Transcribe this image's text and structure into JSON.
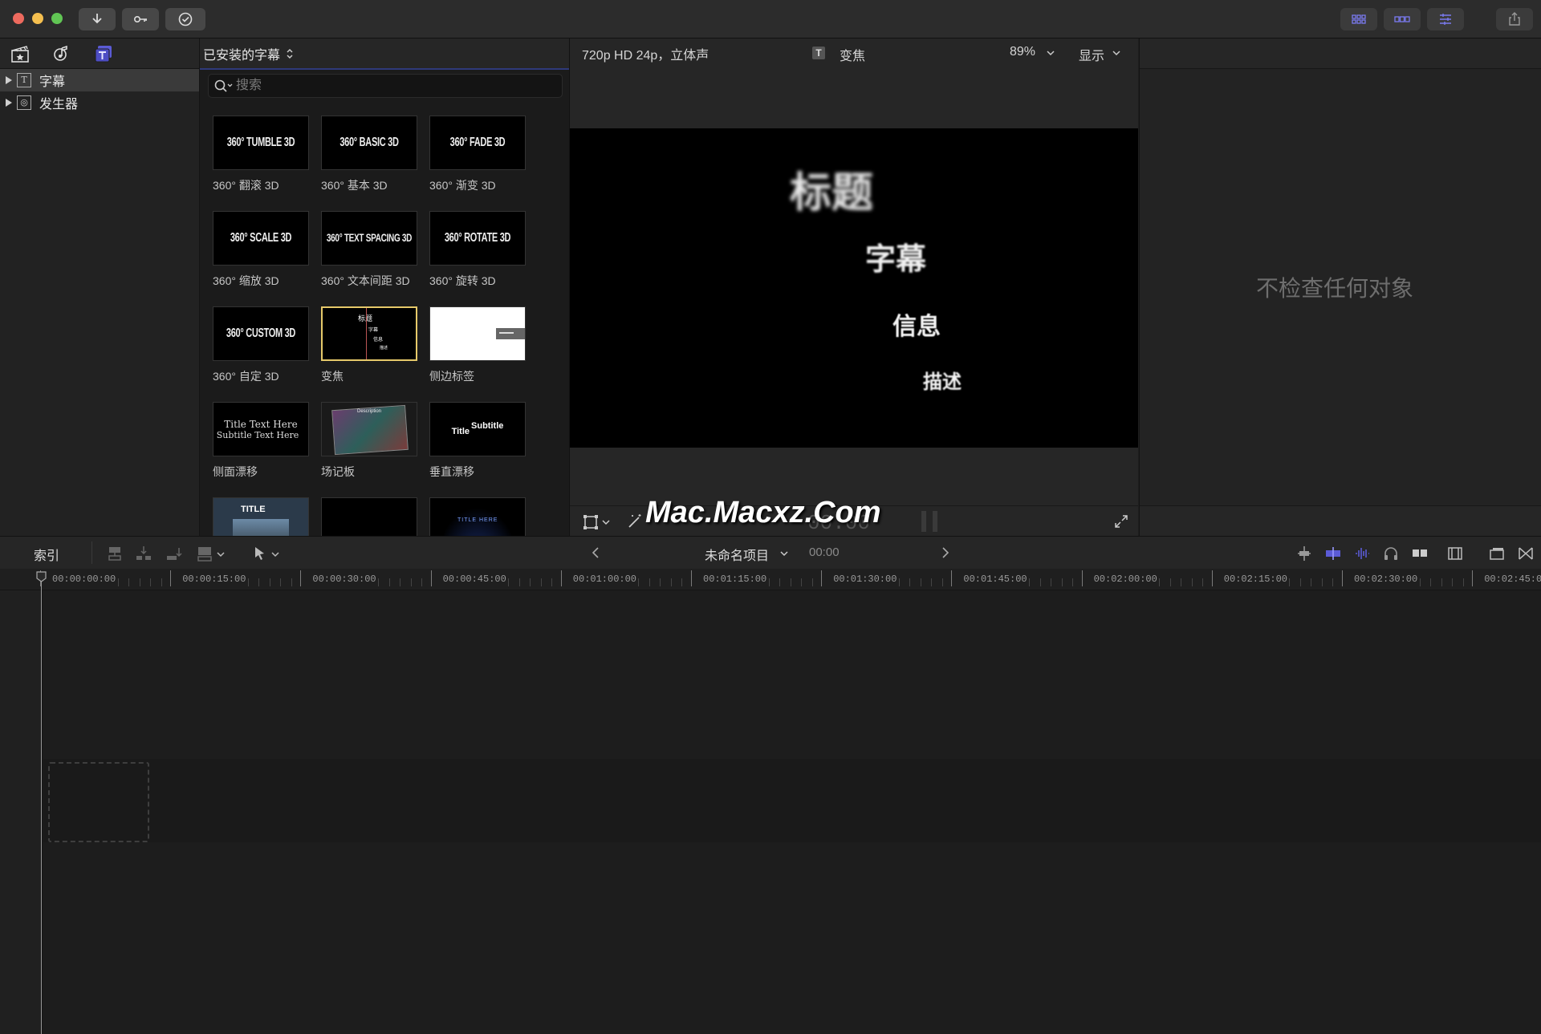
{
  "toolbar": {
    "icons": [
      "import-icon",
      "key-icon",
      "checkmark-icon",
      "browser-layout-icon",
      "timeline-layout-icon",
      "inspector-layout-icon",
      "share-icon"
    ]
  },
  "sidebar": {
    "items": [
      {
        "label": "字幕",
        "glyph": "T",
        "selected": true
      },
      {
        "label": "发生器",
        "glyph": "◎",
        "selected": false
      }
    ]
  },
  "browser": {
    "title": "已安装的字幕",
    "search_placeholder": "搜索",
    "tiles": [
      {
        "thumb": "360° TUMBLE 3D",
        "label": "360° 翻滚 3D"
      },
      {
        "thumb": "360° BASIC 3D",
        "label": "360° 基本 3D"
      },
      {
        "thumb": "360° FADE 3D",
        "label": "360° 渐变 3D"
      },
      {
        "thumb": "360° SCALE 3D",
        "label": "360° 缩放 3D"
      },
      {
        "thumb": "360° TEXT SPACING 3D",
        "label": "360° 文本间距 3D"
      },
      {
        "thumb": "360° ROTATE 3D",
        "label": "360° 旋转 3D"
      },
      {
        "thumb": "360° CUSTOM 3D",
        "label": "360° 自定 3D"
      },
      {
        "thumb": "标题",
        "label": "变焦"
      },
      {
        "thumb": "",
        "label": "侧边标签"
      },
      {
        "thumb": "Title Text Here",
        "label": "侧面漂移"
      },
      {
        "thumb": "Description",
        "label": "场记板"
      },
      {
        "thumb": "Title Subtitle",
        "label": "垂直漂移"
      },
      {
        "thumb": "TITLE",
        "label": ""
      },
      {
        "thumb": "",
        "label": ""
      },
      {
        "thumb": "TITLE HERE",
        "label": ""
      }
    ],
    "thumb_extra": {
      "zoom_lines": [
        "字幕",
        "信息",
        "描述"
      ],
      "side_drift_line2": "Subtitle Text Here",
      "vertical_drift_sub": "Subtitle",
      "vertical_drift_title": "Title"
    }
  },
  "viewer": {
    "format": "720p HD 24p，立体声",
    "clip_name": "变焦",
    "zoom": "89%",
    "display_label": "显示",
    "canvas_texts": [
      "标题",
      "字幕",
      "信息",
      "描述"
    ],
    "watermark": "Mac.Macxz.Com",
    "timecode": "00:00"
  },
  "inspector": {
    "empty_text": "不检查任何对象"
  },
  "timeline": {
    "index_label": "索引",
    "project_name": "未命名项目",
    "project_time": "00:00",
    "ruler_labels": [
      "00:00:00:00",
      "00:00:15:00",
      "00:00:30:00",
      "00:00:45:00",
      "00:01:00:00",
      "00:01:15:00",
      "00:01:30:00",
      "00:01:45:00",
      "00:02:00:00",
      "00:02:15:00",
      "00:02:30:00",
      "00:02:45:00"
    ]
  },
  "colors": {
    "accent": "#5b5bd6",
    "selection": "#e6c96a",
    "close": "#ed6a5e",
    "minimize": "#f5bf4f",
    "maximize": "#61c554"
  }
}
